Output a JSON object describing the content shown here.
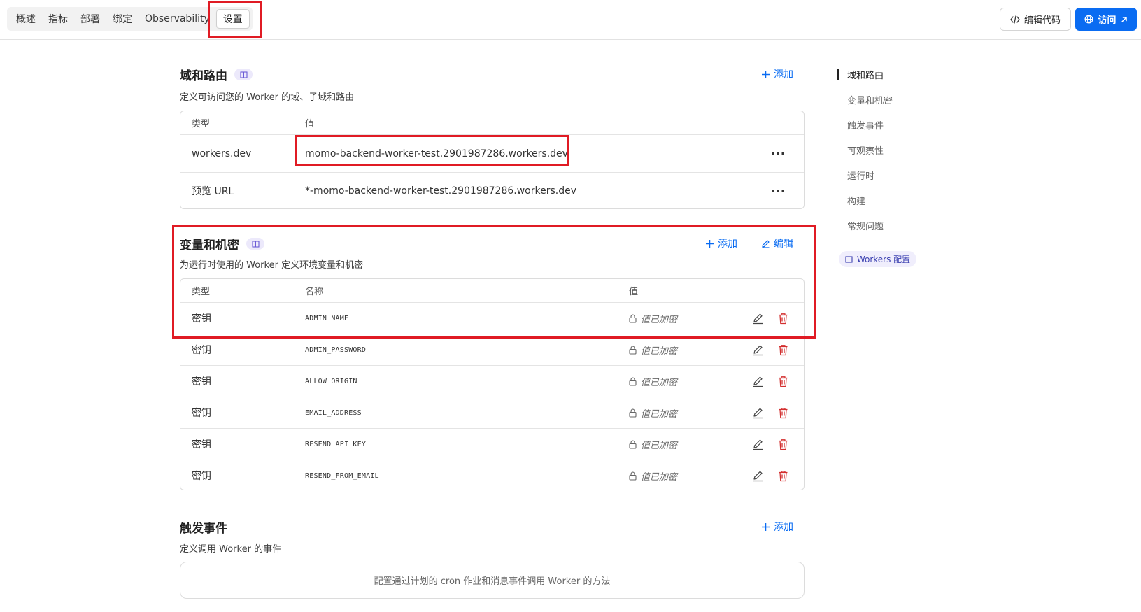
{
  "tabs": [
    {
      "label": "概述"
    },
    {
      "label": "指标"
    },
    {
      "label": "部署"
    },
    {
      "label": "绑定"
    },
    {
      "label": "Observability"
    },
    {
      "label": "设置"
    }
  ],
  "header": {
    "edit_code_label": "编辑代码",
    "visit_label": "访问"
  },
  "domains": {
    "title": "域和路由",
    "desc": "定义可访问您的 Worker 的域、子域和路由",
    "add_label": "添加",
    "col_type": "类型",
    "col_value": "值",
    "rows": [
      {
        "type": "workers.dev",
        "value": "momo-backend-worker-test.2901987286.workers.dev"
      },
      {
        "type": "预览 URL",
        "value": "*-momo-backend-worker-test.2901987286.workers.dev"
      }
    ]
  },
  "variables": {
    "title": "变量和机密",
    "desc": "为运行时使用的 Worker 定义环境变量和机密",
    "add_label": "添加",
    "edit_label": "编辑",
    "col_type": "类型",
    "col_name": "名称",
    "col_value": "值",
    "rows": [
      {
        "type": "密钥",
        "name": "ADMIN_NAME",
        "value": "值已加密"
      },
      {
        "type": "密钥",
        "name": "ADMIN_PASSWORD",
        "value": "值已加密"
      },
      {
        "type": "密钥",
        "name": "ALLOW_ORIGIN",
        "value": "值已加密"
      },
      {
        "type": "密钥",
        "name": "EMAIL_ADDRESS",
        "value": "值已加密"
      },
      {
        "type": "密钥",
        "name": "RESEND_API_KEY",
        "value": "值已加密"
      },
      {
        "type": "密钥",
        "name": "RESEND_FROM_EMAIL",
        "value": "值已加密"
      }
    ]
  },
  "triggers": {
    "title": "触发事件",
    "desc": "定义调用 Worker 的事件",
    "add_label": "添加",
    "empty_text": "配置通过计划的 cron 作业和消息事件调用 Worker 的方法"
  },
  "sidenav": {
    "items": [
      {
        "label": "域和路由"
      },
      {
        "label": "变量和机密"
      },
      {
        "label": "触发事件"
      },
      {
        "label": "可观察性"
      },
      {
        "label": "运行时"
      },
      {
        "label": "构建"
      },
      {
        "label": "常规问题"
      }
    ],
    "workers_config_label": "Workers 配置"
  },
  "colors": {
    "accent": "#0a6cf2",
    "highlight": "#e01b24",
    "delete": "#d32f2f"
  }
}
